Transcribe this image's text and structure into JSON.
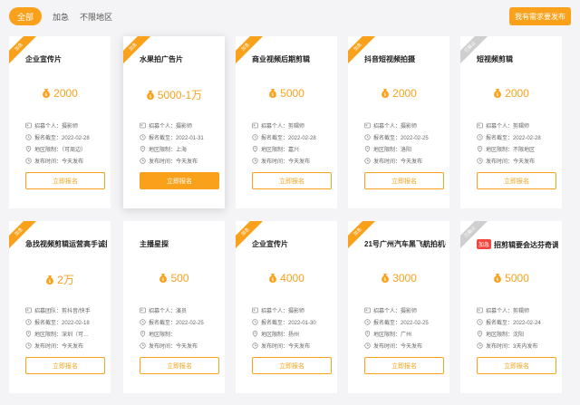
{
  "filters": {
    "all": "全部",
    "urgent": "加急",
    "unlimited": "不限地区"
  },
  "publish_label": "我有需求要发布",
  "colors": {
    "accent": "#f9a11b",
    "urgent_red": "#f2453d"
  },
  "cards": [
    {
      "title": "企业宣传片",
      "urgent": "",
      "price": "2000",
      "ribbon": "加急",
      "ribbon_style": "orange",
      "rows": [
        "招募个人：摄影师",
        "报名截至：2022-02-28",
        "地区限制：（可周边）",
        "发布时间：今天发布"
      ],
      "button": "立即报名",
      "filled": false
    },
    {
      "title": "水果拍广告片",
      "urgent": "",
      "price": "5000-1万",
      "ribbon": "加急",
      "ribbon_style": "orange",
      "rows": [
        "招募个人：摄影师",
        "报名截至：2022-01-31",
        "地区限制：上海",
        "发布时间：今天发布"
      ],
      "button": "立即报名",
      "filled": true
    },
    {
      "title": "商业视频后期剪辑",
      "urgent": "",
      "price": "5000",
      "ribbon": "加急",
      "ribbon_style": "orange",
      "rows": [
        "招募个人：剪辑师",
        "报名截至：2022-02-28",
        "地区限制：嘉兴",
        "发布时间：今天发布"
      ],
      "button": "立即报名",
      "filled": false
    },
    {
      "title": "抖音短视频拍摄",
      "urgent": "",
      "price": "2000",
      "ribbon": "加急",
      "ribbon_style": "orange",
      "rows": [
        "招募个人：摄影师",
        "报名截至：2022-02-25",
        "地区限制：洛阳",
        "发布时间：今天发布"
      ],
      "button": "立即报名",
      "filled": false
    },
    {
      "title": "短视频剪辑",
      "urgent": "",
      "price": "2000",
      "ribbon": "已截止",
      "ribbon_style": "gray",
      "rows": [
        "招募个人：剪辑师",
        "报名截至：2022-02-28",
        "地区限制：不限地区",
        "发布时间：今天发布"
      ],
      "button": "立即报名",
      "filled": false
    },
    {
      "title": "急找视频剪辑运营高手诚招聘",
      "urgent": "",
      "price": "2万",
      "ribbon": "加急",
      "ribbon_style": "orange",
      "rows": [
        "招募团队：剪抖音/快手",
        "报名截至：2022-02-18",
        "地区限制：深圳（可…",
        "发布时间：今天发布"
      ],
      "button": "立即报名",
      "filled": false
    },
    {
      "title": "主播星探",
      "urgent": "",
      "price": "500",
      "ribbon": "",
      "ribbon_style": "none",
      "rows": [
        "招募个人：演员",
        "报名截至：2022-02-25",
        "地区限制：",
        "发布时间：今天发布"
      ],
      "button": "立即报名",
      "filled": false
    },
    {
      "title": "企业宣传片",
      "urgent": "",
      "price": "4000",
      "ribbon": "加急",
      "ribbon_style": "orange",
      "rows": [
        "招募个人：摄影师",
        "报名截至：2022-01-30",
        "地区限制：扬州",
        "发布时间：今天发布"
      ],
      "button": "立即报名",
      "filled": false
    },
    {
      "title": "21号广州汽车黑飞航拍机手",
      "urgent": "",
      "price": "3000",
      "ribbon": "加急",
      "ribbon_style": "orange",
      "rows": [
        "招募个人：摄影师",
        "报名截至：2022-02-25",
        "地区限制：广州",
        "发布时间：今天发布"
      ],
      "button": "立即报名",
      "filled": false
    },
    {
      "title": "招剪辑要会达芬奇调",
      "urgent": "加急",
      "price": "5000",
      "ribbon": "已截止",
      "ribbon_style": "gray",
      "rows": [
        "招募个人：剪辑师",
        "报名截至：2022-02-24",
        "地区限制：沈阳",
        "发布时间：3天内发布"
      ],
      "button": "立即报名",
      "filled": false
    }
  ]
}
